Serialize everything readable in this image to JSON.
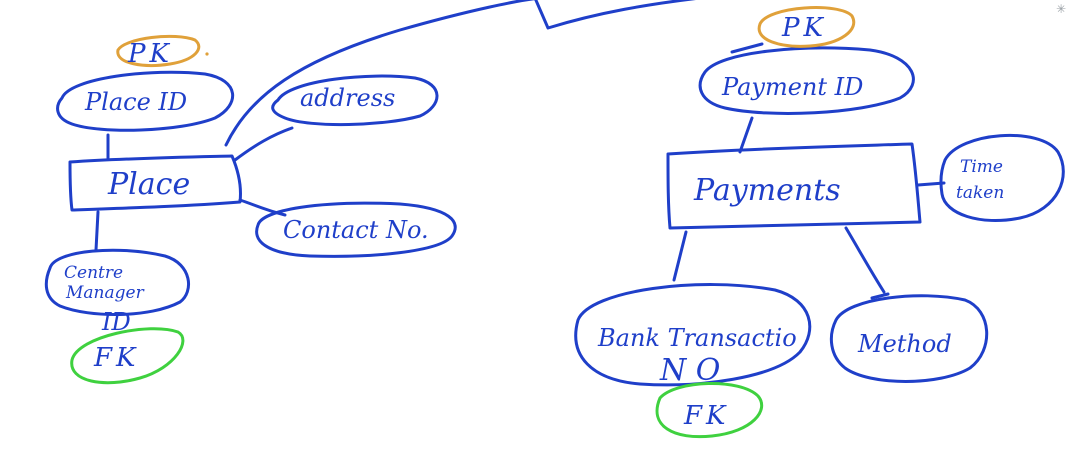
{
  "colors": {
    "ink": "#1f3fc9",
    "primary_key_marker": "#e0a13a",
    "foreign_key_marker": "#3fd13f",
    "background": "#ffffff"
  },
  "icons": {
    "corner": "pin-icon"
  },
  "place": {
    "entity": "Place",
    "attributes": {
      "place_id": "Place ID",
      "address": "address",
      "contact_no": "Contact No.",
      "centre_manager_id_line1": "Centre",
      "centre_manager_id_line2": "Manager",
      "centre_manager_id_line3": "ID"
    },
    "keys": {
      "pk": "PK",
      "fk": "FK"
    }
  },
  "payments": {
    "entity": "Payments",
    "attributes": {
      "payment_id": "Payment ID",
      "time_line1": "Time",
      "time_line2": "taken",
      "bank_transaction_line1": "Bank Transactio",
      "bank_transaction_line2": "N O",
      "method": "Method"
    },
    "keys": {
      "pk": "PK",
      "fk": "FK"
    }
  }
}
